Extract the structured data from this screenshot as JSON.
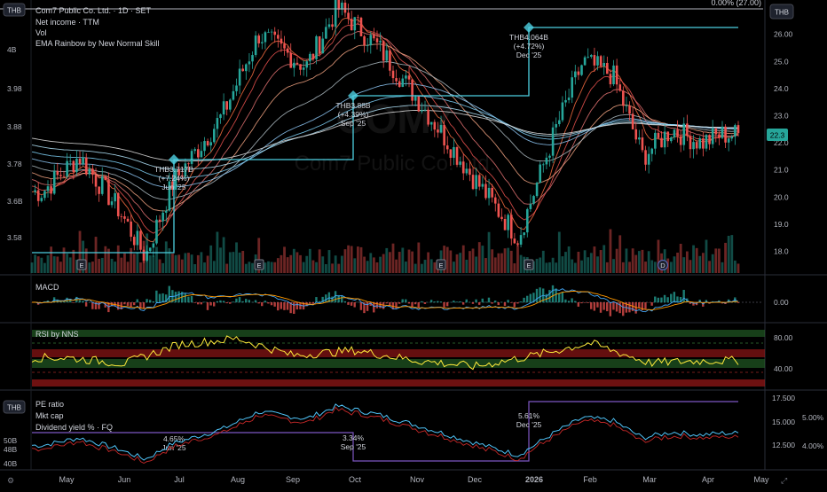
{
  "header": {
    "currency_badge": "THB",
    "symbol_title": "Com7 Public Co. Ltd. · 1D · SET",
    "indicators": [
      "Net income · TTM",
      "Vol",
      "EMA Rainbow by New Normal Skill"
    ],
    "top_right": "0.00% (27.00)"
  },
  "watermark": {
    "ticker": "COM7",
    "company": "Com7 Public Co. Ltd."
  },
  "colors": {
    "up": "#26a69a",
    "down": "#ef5350",
    "line": "#4dd0e1",
    "purple": "#7e57c2",
    "yellow": "#ffeb3b",
    "price_badge": "#26a69a"
  },
  "chart_data": [
    {
      "type": "candlestick",
      "name": "price",
      "price_axis": {
        "ticks": [
          "26.00",
          "25.0",
          "24.0",
          "23.0",
          "22.0",
          "21.0",
          "20.0",
          "19.0",
          "18.0"
        ],
        "range": [
          17.2,
          27.2
        ]
      },
      "left_axis": {
        "ticks": [
          "4B",
          "3.98",
          "3.88",
          "3.78",
          "3.6B",
          "3.58"
        ]
      },
      "last_price": "22.3",
      "series_key_points": [
        {
          "x": "May 1",
          "y": 20.2
        },
        {
          "x": "May 20",
          "y": 21.5
        },
        {
          "x": "Jun 10",
          "y": 19.6
        },
        {
          "x": "Jun 25",
          "y": 17.8
        },
        {
          "x": "Jul 10",
          "y": 20.5
        },
        {
          "x": "Aug 5",
          "y": 23.0
        },
        {
          "x": "Aug 25",
          "y": 26.0
        },
        {
          "x": "Sep 20",
          "y": 24.8
        },
        {
          "x": "Oct 5",
          "y": 27.0
        },
        {
          "x": "Oct 25",
          "y": 25.5
        },
        {
          "x": "Nov 15",
          "y": 23.5
        },
        {
          "x": "Dec 10",
          "y": 21.0
        },
        {
          "x": "Jan 5",
          "y": 18.5
        },
        {
          "x": "Jan 25",
          "y": 22.5
        },
        {
          "x": "Feb 10",
          "y": 25.0
        },
        {
          "x": "Feb 25",
          "y": 24.5
        },
        {
          "x": "Mar 10",
          "y": 21.5
        },
        {
          "x": "Mar 25",
          "y": 22.5
        },
        {
          "x": "Apr 10",
          "y": 22.0
        },
        {
          "x": "Apr 20",
          "y": 22.3
        }
      ],
      "net_income_annotations": [
        {
          "value": "THB3.717B",
          "change": "(+7.24%)",
          "date": "Jun '25"
        },
        {
          "value": "THB3.88B",
          "change": "(+4.39%)",
          "date": "Sep '25"
        },
        {
          "value": "THB4.064B",
          "change": "(+4.72%)",
          "date": "Dec '25"
        }
      ],
      "event_markers": [
        "E",
        "E",
        "E",
        "E",
        "D"
      ]
    },
    {
      "type": "line",
      "name": "MACD",
      "label": "MACD",
      "y_ticks": [
        "0.00"
      ]
    },
    {
      "type": "line",
      "name": "RSI",
      "label": "RSI by NNS",
      "y_ticks": [
        "80.00",
        "40.00"
      ],
      "series_key_points": [
        {
          "x": "May",
          "y": 52
        },
        {
          "x": "Jun",
          "y": 44
        },
        {
          "x": "Jul",
          "y": 70
        },
        {
          "x": "Aug",
          "y": 78
        },
        {
          "x": "Sep",
          "y": 55
        },
        {
          "x": "Oct",
          "y": 62
        },
        {
          "x": "Nov",
          "y": 48
        },
        {
          "x": "Dec",
          "y": 40
        },
        {
          "x": "Jan",
          "y": 55
        },
        {
          "x": "Feb",
          "y": 72
        },
        {
          "x": "Mar",
          "y": 45
        },
        {
          "x": "Apr",
          "y": 48
        }
      ]
    },
    {
      "type": "line",
      "name": "fundamentals",
      "currency_badge": "THB",
      "legend": [
        "PE ratio",
        "Mkt cap",
        "Dividend yield % · FQ"
      ],
      "left_ticks": [
        "50B",
        "48B",
        "40B"
      ],
      "right_ticks": [
        "17.500",
        "15.000",
        "12.500"
      ],
      "yield_ticks": [
        "5.00%",
        "4.00%"
      ],
      "dividend_annotations": [
        {
          "value": "4.65%",
          "date": "Jun '25"
        },
        {
          "value": "3.34%",
          "date": "Sep '25"
        },
        {
          "value": "5.61%",
          "date": "Dec '25"
        }
      ]
    }
  ],
  "x_axis": {
    "labels": [
      "May",
      "Jun",
      "Jul",
      "Aug",
      "Sep",
      "Oct",
      "Nov",
      "Dec",
      "2026",
      "Feb",
      "Mar",
      "Apr",
      "May"
    ]
  },
  "controls": {
    "settings_glyph": "⚙",
    "nav_glyph": "⤢"
  }
}
